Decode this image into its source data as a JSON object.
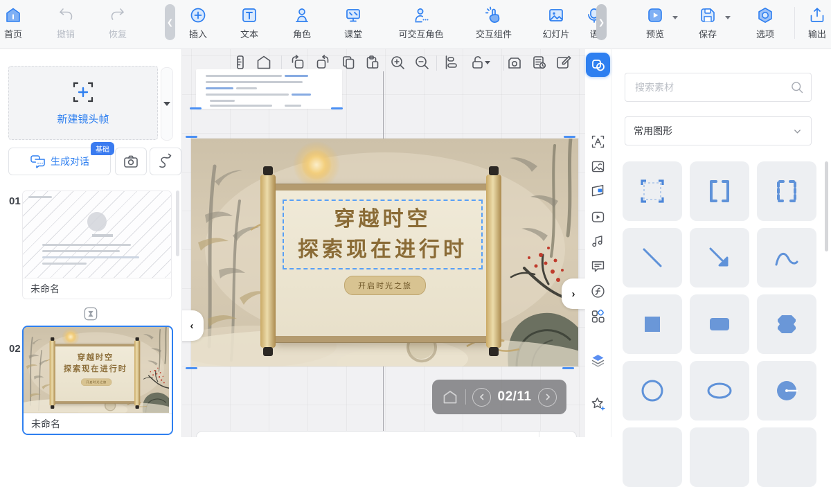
{
  "app": {
    "accent_color": "#2e7ff0"
  },
  "toolbar": {
    "left": [
      {
        "label": "首页"
      },
      {
        "label": "撤销",
        "disabled": true
      },
      {
        "label": "恢复",
        "disabled": true
      }
    ],
    "middle": [
      {
        "label": "插入"
      },
      {
        "label": "文本"
      },
      {
        "label": "角色"
      },
      {
        "label": "课堂"
      },
      {
        "label": "可交互角色"
      },
      {
        "label": "交互组件"
      },
      {
        "label": "幻灯片"
      },
      {
        "label": "语"
      }
    ],
    "right": [
      {
        "label": "预览",
        "has_dropdown": true
      },
      {
        "label": "保存",
        "has_dropdown": true
      },
      {
        "label": "选项"
      },
      {
        "label": "输出"
      }
    ]
  },
  "left_panel": {
    "new_frame": "新建镜头帧",
    "generate_dialog": "生成对话",
    "badge": "基础",
    "slides": [
      {
        "no": "01",
        "name": "未命名",
        "selected": false
      },
      {
        "no": "02",
        "name": "未命名",
        "selected": true
      }
    ]
  },
  "canvas": {
    "toolbar_icons": [
      "ruler",
      "home",
      "rotate-left",
      "rotate-right",
      "copy",
      "paste",
      "zoom-in",
      "zoom-out",
      "align",
      "unlock",
      "camera",
      "history",
      "edit"
    ],
    "frame_title_line1": "穿越时空",
    "frame_title_line2": "探索现在进行时",
    "frame_button": "开启时光之旅",
    "page_indicator": "02/11"
  },
  "side_toolbar": {
    "active": "shapes-panel",
    "items": [
      "shapes-panel",
      "text",
      "image",
      "template",
      "video",
      "music",
      "subtitle",
      "formula",
      "widgets",
      "layers",
      "favorites"
    ]
  },
  "right_panel": {
    "search_placeholder": "搜索素材",
    "category": "常用图形",
    "shapes": [
      "selection-frame",
      "brackets",
      "dashed-brackets",
      "diagonal-line",
      "diagonal-arrow",
      "curve",
      "square",
      "rounded-rectangle",
      "octagon",
      "circle",
      "ellipse",
      "pie"
    ]
  }
}
